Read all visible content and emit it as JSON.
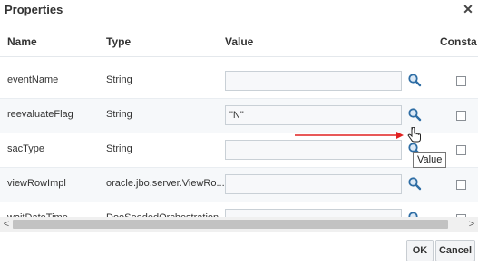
{
  "dialog": {
    "title": "Properties",
    "close_glyph": "✕"
  },
  "table": {
    "headers": {
      "name": "Name",
      "type": "Type",
      "value": "Value",
      "constant": "Consta"
    },
    "rows": [
      {
        "name": "eventName",
        "type": "String",
        "value": ""
      },
      {
        "name": "reevaluateFlag",
        "type": "String",
        "value": "\"N\""
      },
      {
        "name": "sacType",
        "type": "String",
        "value": ""
      },
      {
        "name": "viewRowImpl",
        "type": "oracle.jbo.server.ViewRo...",
        "value": ""
      },
      {
        "name": "waitDateTime",
        "type": "DooSeededOrchestration...",
        "value": ""
      }
    ]
  },
  "scrollbar": {
    "left_glyph": "<",
    "right_glyph": ">"
  },
  "tooltip": {
    "text": "Value"
  },
  "buttons": {
    "ok": "OK",
    "cancel": "Cancel"
  },
  "icons": {
    "search": "magnifier-icon",
    "pointer": "hand-cursor-icon",
    "annotation": "red-arrow"
  },
  "colors": {
    "annotation_arrow": "#e02020",
    "search_icon": "#2e6da4"
  }
}
